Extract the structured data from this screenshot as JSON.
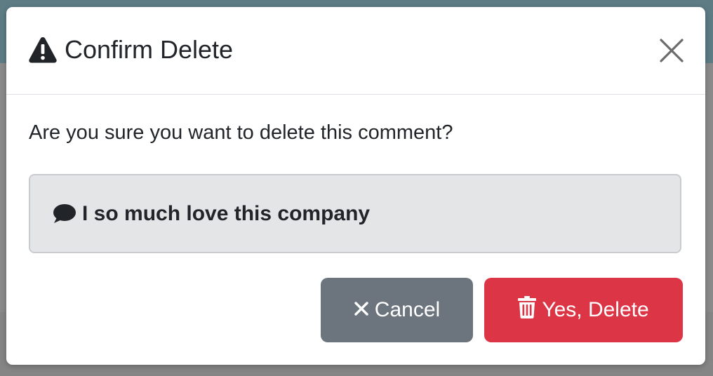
{
  "modal": {
    "title": "Confirm Delete",
    "title_icon": "warning-triangle-icon",
    "close_icon": "close-icon",
    "question": "Are you sure you want to delete this comment?",
    "comment": {
      "icon": "comment-icon",
      "text": "I so much love this company"
    },
    "buttons": {
      "cancel_label": "Cancel",
      "cancel_icon": "times-icon",
      "delete_label": "Yes, Delete",
      "delete_icon": "trash-icon"
    }
  },
  "colors": {
    "cancel": "#6c757d",
    "delete": "#dc3545",
    "comment_bg": "#e4e5e7",
    "text": "#212529"
  }
}
